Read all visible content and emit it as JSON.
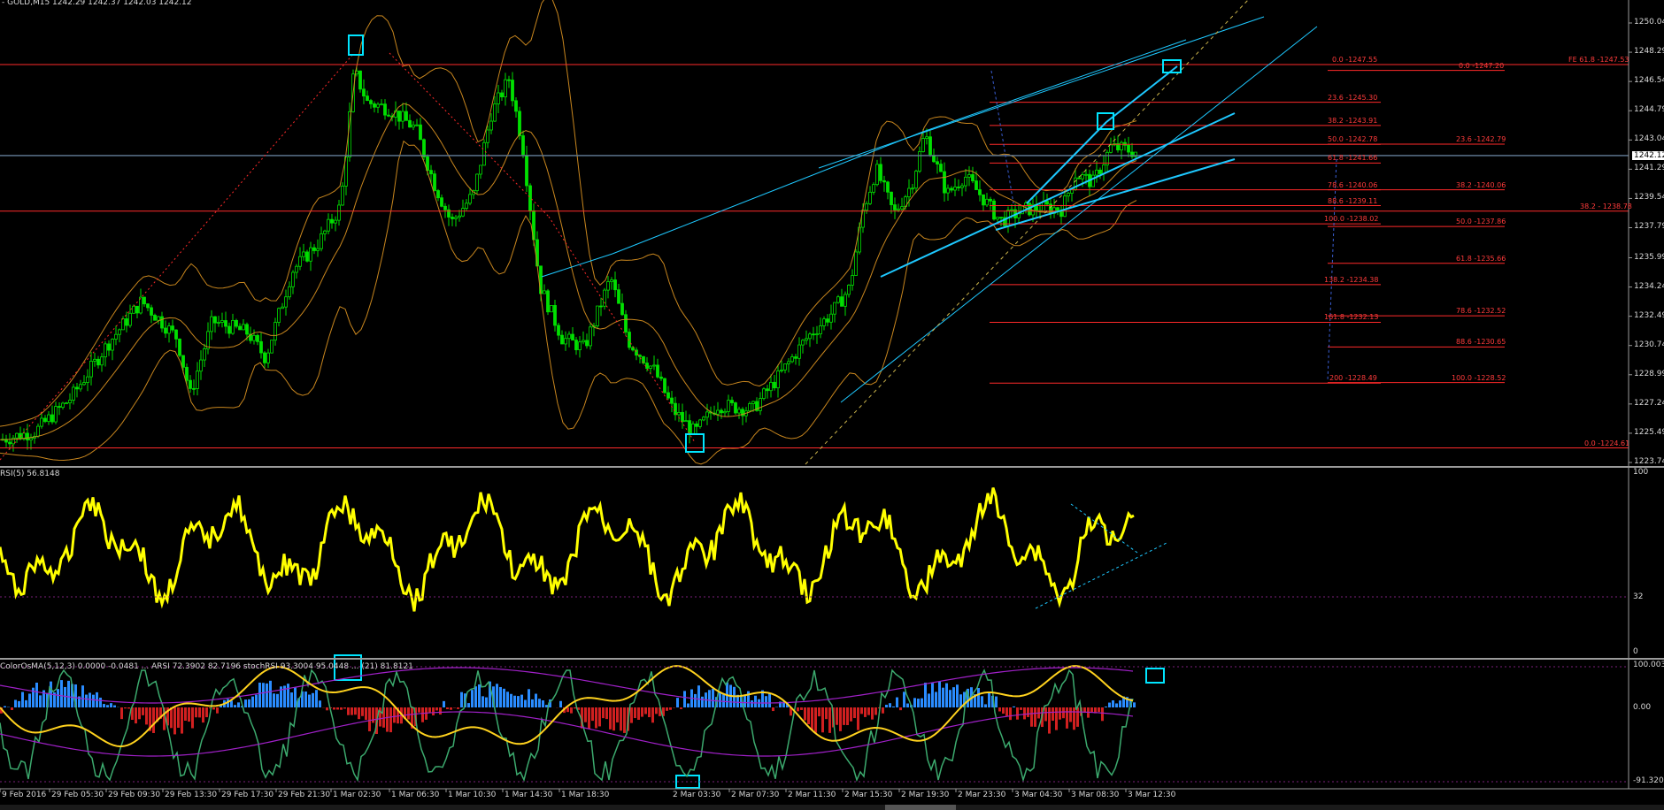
{
  "header": {
    "symbol_info": "- GOLD,M15  1242.29 1242.37 1242.03 1242.12"
  },
  "price_axis": {
    "labels": [
      "1250.04",
      "1248.29",
      "1246.54",
      "1244.79",
      "1243.04",
      "1242.12",
      "1241.29",
      "1239.54",
      "1237.79",
      "1235.99",
      "1234.24",
      "1232.49",
      "1230.74",
      "1228.99",
      "1227.24",
      "1225.49",
      "1223.74"
    ],
    "current_price": "1242.12"
  },
  "time_axis": {
    "labels": [
      "9 Feb 2016",
      "29 Feb 05:30",
      "29 Feb 09:30",
      "29 Feb 13:30",
      "29 Feb 17:30",
      "29 Feb 21:30",
      "1 Mar 02:30",
      "1 Mar 06:30",
      "1 Mar 10:30",
      "1 Mar 14:30",
      "1 Mar 18:30",
      "2 Mar 03:30",
      "2 Mar 07:30",
      "2 Mar 11:30",
      "2 Mar 15:30",
      "2 Mar 19:30",
      "2 Mar 23:30",
      "3 Mar 04:30",
      "3 Mar 08:30",
      "3 Mar 12:30"
    ]
  },
  "fib_levels": [
    {
      "text": "0.0 -1247.55"
    },
    {
      "text": "0.0 -1247.20"
    },
    {
      "text": "FE 61.8 -1247.53"
    },
    {
      "text": "23.6 -1245.30"
    },
    {
      "text": "38.2 -1243.91"
    },
    {
      "text": "50.0 -1242.78"
    },
    {
      "text": "23.6 -1242.79"
    },
    {
      "text": "61.8 -1241.66"
    },
    {
      "text": "78.6 -1240.06"
    },
    {
      "text": "38.2 -1240.06"
    },
    {
      "text": "88.6 -1239.11"
    },
    {
      "text": "38.2 - 1238.78"
    },
    {
      "text": "100.0 -1238.02"
    },
    {
      "text": "50.0 -1237.86"
    },
    {
      "text": "61.8 -1235.66"
    },
    {
      "text": "138.2 -1234.38"
    },
    {
      "text": "78.6 -1232.52"
    },
    {
      "text": "161.8 -1232.13"
    },
    {
      "text": "88.6 -1230.65"
    },
    {
      "text": "200 -1228.49"
    },
    {
      "text": "100.0 -1228.52"
    },
    {
      "text": "0.0 -1224.61"
    }
  ],
  "rsi_pane": {
    "label": "RSI(5) 56.8148",
    "scale": [
      "100",
      "32",
      "0"
    ]
  },
  "osc_pane": {
    "label": "ColorOsMA(5,12,3) 0.0000 -0.0481 ... ARSI 72.3902 82.7196 stochRSI 93.3004 95.0448 ... (21) 81.8121",
    "scale": [
      "100.003",
      "0.00",
      "-91.3204"
    ]
  },
  "colors": {
    "background": "#000000",
    "candle": "#00e000",
    "bands": "#c8861e",
    "fib": "#ff2a2a",
    "trend": "#1ec8ff",
    "rsi": "#ffff00",
    "osc_up": "#2a8cff",
    "osc_down": "#d02020",
    "marker": "#00e5ff",
    "grid_dash": "#7a1f7a"
  }
}
